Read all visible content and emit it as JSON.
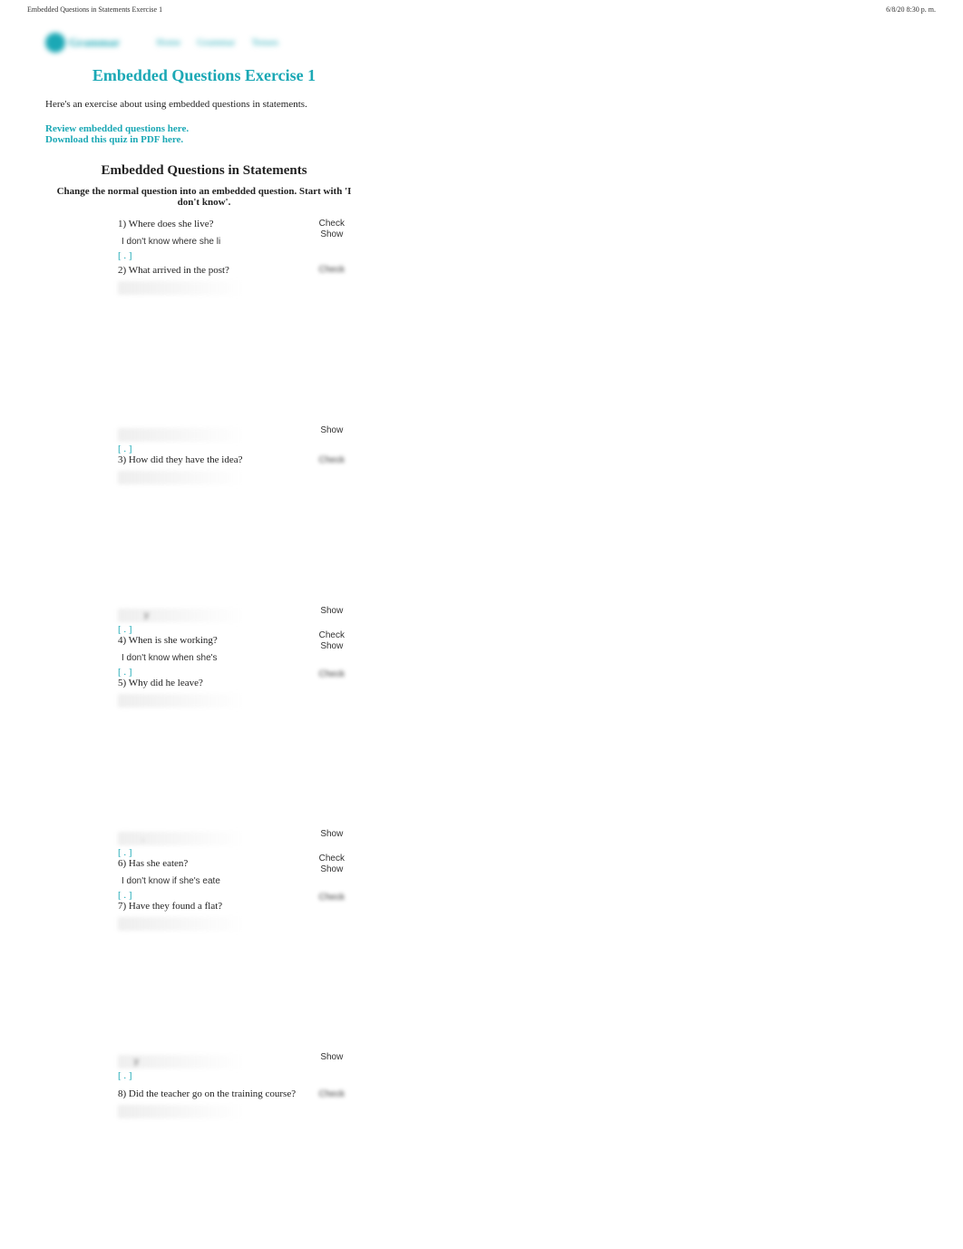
{
  "header": {
    "left": "Embedded Questions in Statements Exercise 1",
    "right": "6/8/20 8:30 p. m."
  },
  "nav": {
    "logo_text": "Grammar",
    "links": [
      "Home",
      "Grammar",
      "Tenses"
    ]
  },
  "page_title": "Embedded Questions Exercise 1",
  "intro": "Here's an exercise about using embedded questions in statements.",
  "link_review": "Review embedded questions here.",
  "link_download": "Download this quiz in PDF here.",
  "section_title": "Embedded Questions in Statements",
  "instruction": "Change the normal question into an embedded question. Start with 'I don't know'.",
  "btn_check": "Check",
  "btn_show": "Show",
  "bracket": "[ . ]",
  "questions": [
    {
      "num": "1)",
      "q": "Where does she live?",
      "ans": "I don't know where she li"
    },
    {
      "num": "2)",
      "q": "What arrived in the post?",
      "ans": ""
    },
    {
      "num": "3)",
      "q": "How did they have the idea?",
      "ans": ""
    },
    {
      "num": "4)",
      "q": "When is she working?",
      "ans": "I don't know when she's"
    },
    {
      "num": "5)",
      "q": "Why did he leave?",
      "ans": ""
    },
    {
      "num": "6)",
      "q": "Has she eaten?",
      "ans": "I don't know if she's eate"
    },
    {
      "num": "7)",
      "q": "Have they found a flat?",
      "ans": ""
    },
    {
      "num": "8)",
      "q": "Did the teacher go on the training course?",
      "ans": ""
    }
  ]
}
